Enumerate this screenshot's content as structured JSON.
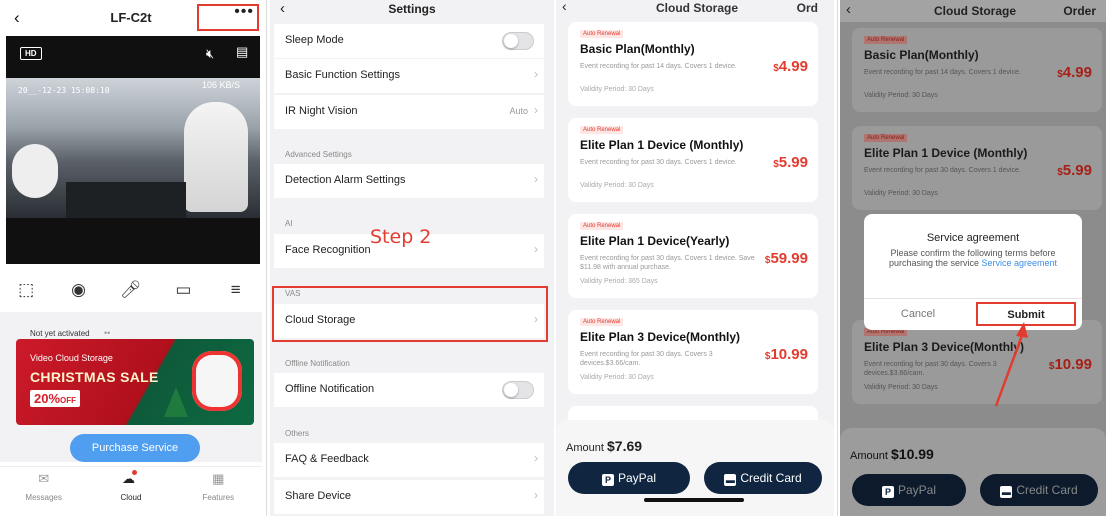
{
  "panel1": {
    "title": "LF-C2t",
    "hd": "HD",
    "timestamp": "20__-12-23 15:08:10",
    "speed": "106 KB/S",
    "not_activated": "Not yet activated",
    "banner_sub": "Video Cloud Storage",
    "banner_title": "CHRISTMAS SALE",
    "banner_pct": "20%",
    "banner_off": "OFF",
    "purchase": "Purchase Service",
    "tabs": [
      {
        "label": "Messages",
        "icon": "message-icon"
      },
      {
        "label": "Cloud",
        "icon": "cloud-icon"
      },
      {
        "label": "Features",
        "icon": "grid-icon"
      }
    ]
  },
  "panel2": {
    "title": "Settings",
    "rows": {
      "sleep": "Sleep Mode",
      "basic": "Basic Function Settings",
      "ir": "IR Night Vision",
      "ir_value": "Auto",
      "advanced_section": "Advanced Settings",
      "detection": "Detection Alarm Settings",
      "ai_section": "AI",
      "face": "Face Recognition",
      "vas_section": "VAS",
      "cloud": "Cloud Storage",
      "offline_section": "Offline Notification",
      "offline": "Offline Notification",
      "others_section": "Others",
      "faq": "FAQ & Feedback",
      "share": "Share Device"
    },
    "step": "Step 2"
  },
  "panel3": {
    "title": "Cloud Storage",
    "order": "Ord",
    "plans": [
      {
        "tag": "Auto Renewal",
        "name": "Basic Plan(Monthly)",
        "desc": "Event recording for past 14 days. Covers 1 device.",
        "validity": "Validity Period: 30 Days",
        "currency": "$",
        "price": "4.99"
      },
      {
        "tag": "Auto Renewal",
        "name": "Elite Plan 1 Device (Monthly)",
        "desc": "Event recording for past 30 days. Covers 1 device.",
        "validity": "Validity Period: 30 Days",
        "currency": "$",
        "price": "5.99"
      },
      {
        "tag": "Auto Renewal",
        "name": "Elite Plan 1 Device(Yearly)",
        "desc": "Event recording for past 30 days. Covers 1 device. Save $11.98 with annual purchase.",
        "validity": "Validity Period: 365 Days",
        "currency": "$",
        "price": "59.99"
      },
      {
        "tag": "Auto Renewal",
        "name": "Elite Plan 3 Device(Monthly)",
        "desc": "Event recording for past 30 days. Covers 3 devices.$3.66/cam.",
        "validity": "Validity Period: 30 Days",
        "currency": "$",
        "price": "10.99"
      }
    ],
    "amount_label": "Amount",
    "amount_currency": "$",
    "amount_value": "7.69",
    "paypal": "PayPal",
    "card": "Credit Card"
  },
  "panel4": {
    "title": "Cloud Storage",
    "order": "Order",
    "amount_value": "10.99",
    "dialog": {
      "title": "Service agreement",
      "text": "Please confirm the following terms before purchasing the service",
      "link": "Service agreement",
      "cancel": "Cancel",
      "submit": "Submit"
    }
  },
  "colors": {
    "accent_red": "#e23c30",
    "link_blue": "#3a8de8",
    "purchase_blue": "#4f9ef0",
    "pay_navy": "#0f2540"
  }
}
